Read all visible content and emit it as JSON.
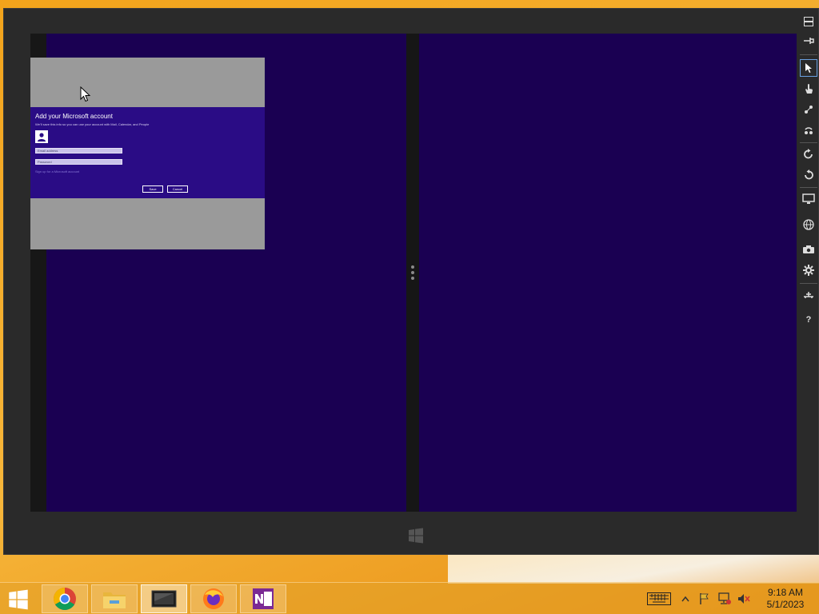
{
  "dialog": {
    "title": "Add your Microsoft account",
    "description": "We'll save this info so you can use your account with Mail, Calendar, and People",
    "email_placeholder": "Email address",
    "password_placeholder": "Password",
    "forgot_link": "Sign up for a Microsoft account",
    "save_label": "Save",
    "cancel_label": "Cancel"
  },
  "toolbar": {
    "items": [
      {
        "icon": "minimize-icon"
      },
      {
        "icon": "pin-icon"
      },
      {
        "icon": "mouse-mode-icon"
      },
      {
        "icon": "touch-mode-icon"
      },
      {
        "icon": "pinch-zoom-icon"
      },
      {
        "icon": "rotate-touch-icon"
      },
      {
        "icon": "rotate-clockwise-icon"
      },
      {
        "icon": "rotate-counterclockwise-icon"
      },
      {
        "icon": "change-resolution-icon"
      },
      {
        "icon": "location-icon"
      },
      {
        "icon": "screenshot-icon"
      },
      {
        "icon": "network-settings-icon"
      },
      {
        "icon": "help-icon"
      }
    ]
  },
  "taskbar": {
    "apps": [
      {
        "name": "Google Chrome",
        "icon": "chrome-icon"
      },
      {
        "name": "File Explorer",
        "icon": "file-explorer-icon"
      },
      {
        "name": "Simulator",
        "icon": "simulator-icon"
      },
      {
        "name": "Firefox",
        "icon": "firefox-icon"
      },
      {
        "name": "OneNote",
        "icon": "onenote-icon"
      }
    ],
    "time": "9:18 AM",
    "date": "5/1/2023"
  },
  "colors": {
    "screen_bg": "#1a0052",
    "dialog_bg": "#2a0c85",
    "wallpaper": "#f2a31b"
  }
}
